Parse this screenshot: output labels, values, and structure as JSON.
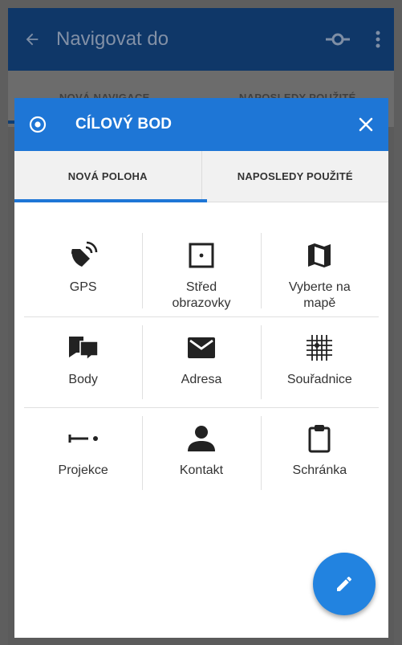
{
  "appbar": {
    "title": "Navigovat do"
  },
  "background_tabs": [
    {
      "label": "NOVÁ NAVIGACE"
    },
    {
      "label": "NAPOSLEDY POUŽITÉ"
    }
  ],
  "dialog": {
    "title": "CÍLOVÝ BOD",
    "tabs": [
      {
        "label": "NOVÁ POLOHA",
        "selected": true
      },
      {
        "label": "NAPOSLEDY POUŽITÉ",
        "selected": false
      }
    ],
    "options": [
      {
        "label": "GPS",
        "icon": "satellite-dish-icon"
      },
      {
        "label": "Střed\nobrazovky",
        "icon": "screen-center-icon"
      },
      {
        "label": "Vyberte na\nmapě",
        "icon": "map-icon"
      },
      {
        "label": "Body",
        "icon": "points-icon"
      },
      {
        "label": "Adresa",
        "icon": "envelope-icon"
      },
      {
        "label": "Souřadnice",
        "icon": "coordinates-grid-icon"
      },
      {
        "label": "Projekce",
        "icon": "projection-icon"
      },
      {
        "label": "Kontakt",
        "icon": "contact-icon"
      },
      {
        "label": "Schránka",
        "icon": "clipboard-icon"
      }
    ],
    "fab_icon": "pencil-icon"
  },
  "colors": {
    "primary": "#1e76d6",
    "appbar_dimmed": "#0f3768",
    "fab": "#2283e0"
  }
}
